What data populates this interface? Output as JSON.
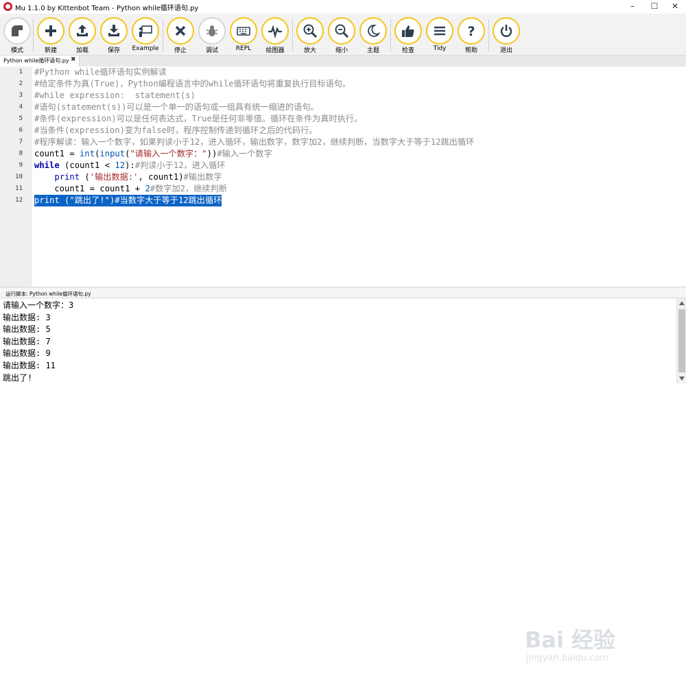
{
  "window": {
    "title": "Mu 1.1.0 by Kittenbot Team - Python while循环语句.py",
    "minimize": "–",
    "maximize": "☐",
    "close": "✕"
  },
  "toolbar": {
    "buttons": [
      {
        "name": "mode",
        "label": "模式",
        "icon": "mode-icon"
      },
      {
        "name": "new",
        "label": "新建",
        "icon": "plus-icon"
      },
      {
        "name": "load",
        "label": "加载",
        "icon": "upload-icon"
      },
      {
        "name": "save",
        "label": "保存",
        "icon": "download-icon"
      },
      {
        "name": "example",
        "label": "Example",
        "icon": "presentation-icon"
      },
      {
        "name": "stop",
        "label": "停止",
        "icon": "x-icon"
      },
      {
        "name": "debug",
        "label": "调试",
        "icon": "bug-icon"
      },
      {
        "name": "repl",
        "label": "REPL",
        "icon": "keyboard-icon"
      },
      {
        "name": "plotter",
        "label": "绘图器",
        "icon": "pulse-icon"
      },
      {
        "name": "zoom-in",
        "label": "放大",
        "icon": "zoom-in-icon"
      },
      {
        "name": "zoom-out",
        "label": "缩小",
        "icon": "zoom-out-icon"
      },
      {
        "name": "theme",
        "label": "主题",
        "icon": "moon-icon"
      },
      {
        "name": "check",
        "label": "检查",
        "icon": "thumbs-up-icon"
      },
      {
        "name": "tidy",
        "label": "Tidy",
        "icon": "menu-lines-icon"
      },
      {
        "name": "help",
        "label": "帮助",
        "icon": "question-icon"
      },
      {
        "name": "quit",
        "label": "退出",
        "icon": "power-icon"
      }
    ]
  },
  "tab": {
    "label": "Python while循环语句.py",
    "close": "✖"
  },
  "editor": {
    "line_numbers": [
      "1",
      "2",
      "3",
      "4",
      "5",
      "6",
      "7",
      "8",
      "9",
      "10",
      "11",
      "12"
    ],
    "lines": [
      "#Python while循环语句实例解读",
      "#给定条件为真(True)，Python编程语言中的while循环语句将重复执行目标语句。",
      "#while expression:  statement(s)",
      "#语句(statement(s))可以是一个单一的语句或一组具有统一缩进的语句。",
      "#条件(expression)可以是任何表达式，True是任何非零值。循环在条件为真时执行。",
      "#当条件(expression)变为false时，程序控制传递到循环之后的代码行。",
      "#程序解读：输入一个数字，如果判读小于12，进入循环，输出数字，数字加2，继续判断，当数字大于等于12跳出循环",
      "count1 = int(input(\"请输入一个数字：\"))#输入一个数字",
      "while (count1 < 12):#判读小于12，进入循环",
      "    print ('输出数据:', count1)#输出数字",
      "    count1 = count1 + 2#数字加2，继续判断",
      "print (\"跳出了!\")#当数字大于等于12跳出循环"
    ]
  },
  "run_panel": {
    "label": "运行脚本: Python while循环语句.py",
    "output": [
      "请输入一个数字：3",
      "输出数据: 3",
      "输出数据: 5",
      "输出数据: 7",
      "输出数据: 9",
      "输出数据: 11",
      "跳出了!"
    ]
  },
  "watermark": {
    "brand": "Bai 经验",
    "url": "jingyan.baidu.com"
  },
  "colors": {
    "accent": "#f5c518",
    "selection": "#0b63c5",
    "comment": "#8a8a8a",
    "keyword": "#0000aa",
    "string": "#a52a2a"
  }
}
